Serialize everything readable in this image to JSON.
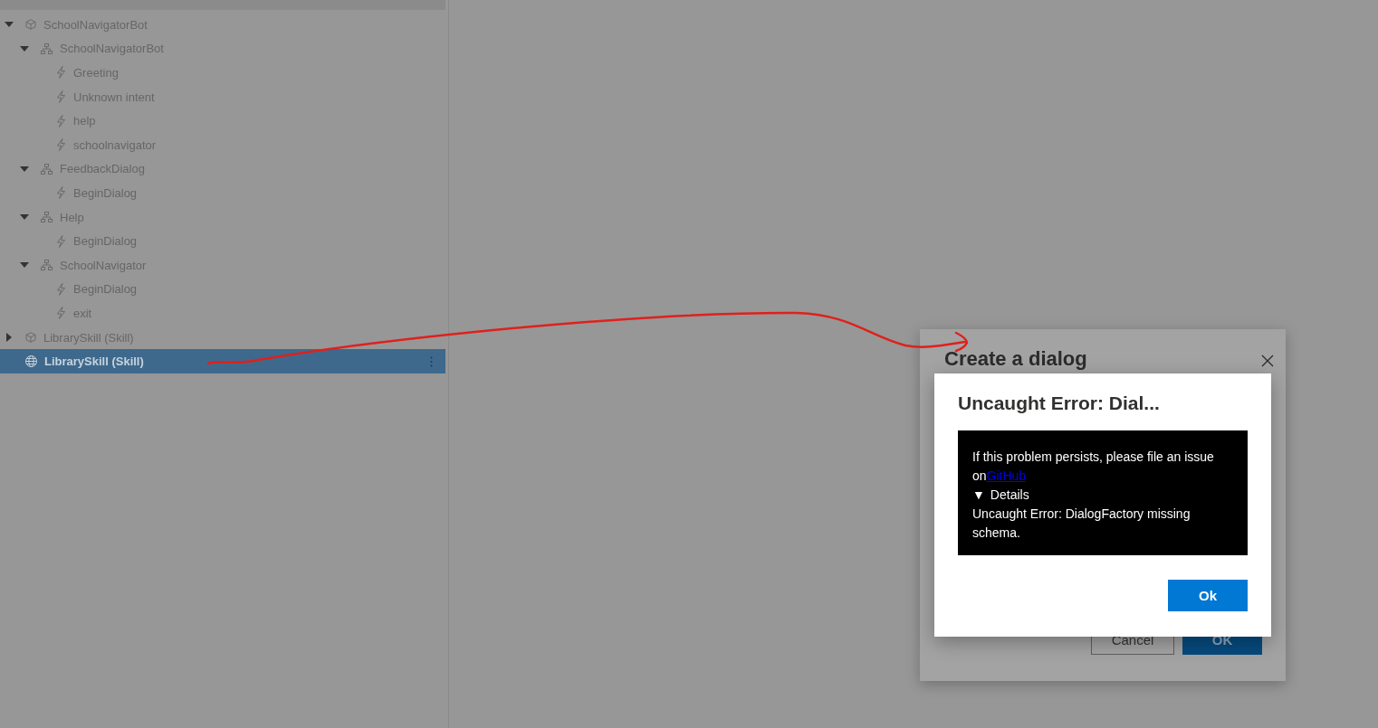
{
  "tree": [
    {
      "label": "SchoolNavigatorBot",
      "kind": "project",
      "expanded": true,
      "selected": false,
      "children": [
        {
          "label": "SchoolNavigatorBot",
          "kind": "dialog",
          "expanded": true,
          "selected": false,
          "children": [
            {
              "label": "Greeting",
              "kind": "trigger",
              "selected": false
            },
            {
              "label": "Unknown intent",
              "kind": "trigger",
              "selected": false
            },
            {
              "label": "help",
              "kind": "trigger",
              "selected": false
            },
            {
              "label": "schoolnavigator",
              "kind": "trigger",
              "selected": false
            }
          ]
        },
        {
          "label": "FeedbackDialog",
          "kind": "dialog",
          "expanded": true,
          "selected": false,
          "children": [
            {
              "label": "BeginDialog",
              "kind": "trigger",
              "selected": false
            }
          ]
        },
        {
          "label": "Help",
          "kind": "dialog",
          "expanded": true,
          "selected": false,
          "children": [
            {
              "label": "BeginDialog",
              "kind": "trigger",
              "selected": false
            }
          ]
        },
        {
          "label": "SchoolNavigator",
          "kind": "dialog",
          "expanded": true,
          "selected": false,
          "children": [
            {
              "label": "BeginDialog",
              "kind": "trigger",
              "selected": false
            },
            {
              "label": "exit",
              "kind": "trigger",
              "selected": false
            }
          ]
        }
      ]
    },
    {
      "label": "LibrarySkill (Skill)",
      "kind": "project",
      "expanded": false,
      "selected": false
    },
    {
      "label": "LibrarySkill (Skill)",
      "kind": "skill",
      "selected": true
    }
  ],
  "create_dialog": {
    "title": "Create a dialog",
    "buttons": [
      {
        "label": "Cancel",
        "kind": "secondary"
      },
      {
        "label": "OK",
        "kind": "primary"
      }
    ]
  },
  "error_dialog": {
    "title": "Uncaught Error: Dial...",
    "message": "If this problem persists, please file an issue on",
    "link": "GitHub",
    "details_toggle": "▼",
    "details_label": "Details",
    "details": "Uncaught Error: DialogFactory missing schema.",
    "button": "Ok"
  }
}
